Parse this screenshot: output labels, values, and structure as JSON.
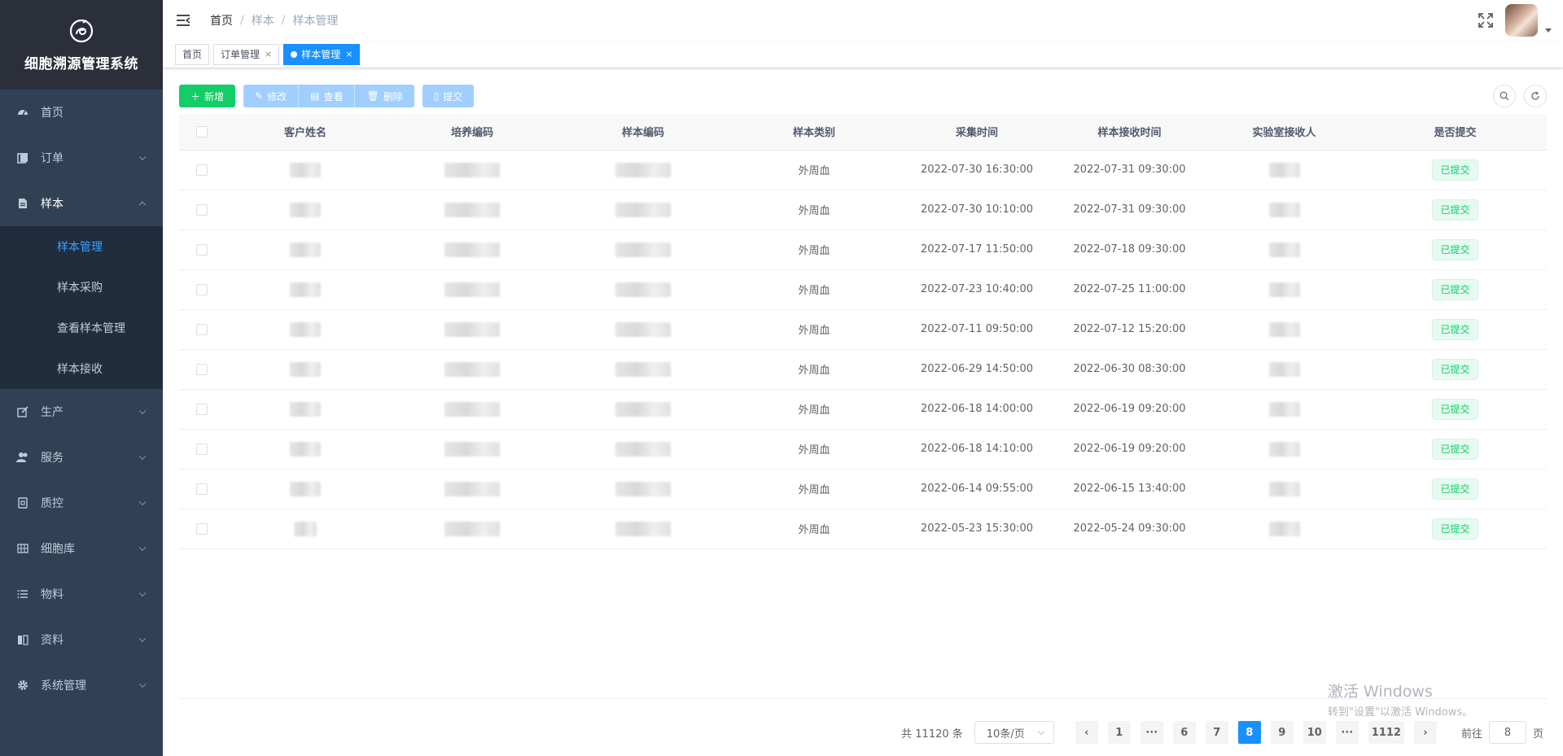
{
  "app": {
    "title": "细胞溯源管理系统"
  },
  "sidebar": {
    "items": [
      {
        "label": "首页",
        "icon": "dashboard-icon"
      },
      {
        "label": "订单",
        "icon": "order-icon",
        "expandable": true
      },
      {
        "label": "样本",
        "icon": "document-icon",
        "expandable": true,
        "expanded": true,
        "children": [
          {
            "label": "样本管理",
            "active": true
          },
          {
            "label": "样本采购"
          },
          {
            "label": "查看样本管理"
          },
          {
            "label": "样本接收"
          }
        ]
      },
      {
        "label": "生产",
        "icon": "edit-icon",
        "expandable": true
      },
      {
        "label": "服务",
        "icon": "peoples-icon",
        "expandable": true
      },
      {
        "label": "质控",
        "icon": "log-icon",
        "expandable": true
      },
      {
        "label": "细胞库",
        "icon": "grid-icon",
        "expandable": true
      },
      {
        "label": "物料",
        "icon": "list-icon",
        "expandable": true
      },
      {
        "label": "资料",
        "icon": "book-icon",
        "expandable": true
      },
      {
        "label": "系统管理",
        "icon": "gear-icon",
        "expandable": true
      }
    ]
  },
  "breadcrumb": [
    "首页",
    "样本",
    "样本管理"
  ],
  "tags": [
    {
      "label": "首页",
      "active": false,
      "closable": false
    },
    {
      "label": "订单管理",
      "active": false,
      "closable": true
    },
    {
      "label": "样本管理",
      "active": true,
      "closable": true
    }
  ],
  "toolbar": {
    "add": "新增",
    "edit": "修改",
    "view": "查看",
    "delete": "删除",
    "submit": "提交"
  },
  "table": {
    "columns": [
      "客户姓名",
      "培养编码",
      "样本编码",
      "样本类别",
      "采集时间",
      "样本接收时间",
      "实验室接收人",
      "是否提交"
    ],
    "rows": [
      {
        "category": "外周血",
        "collect_time": "2022-07-30 16:30:00",
        "receive_time": "2022-07-31 09:30:00",
        "status": "已提交"
      },
      {
        "category": "外周血",
        "collect_time": "2022-07-30 10:10:00",
        "receive_time": "2022-07-31 09:30:00",
        "status": "已提交"
      },
      {
        "category": "外周血",
        "collect_time": "2022-07-17 11:50:00",
        "receive_time": "2022-07-18 09:30:00",
        "status": "已提交"
      },
      {
        "category": "外周血",
        "collect_time": "2022-07-23 10:40:00",
        "receive_time": "2022-07-25 11:00:00",
        "status": "已提交"
      },
      {
        "category": "外周血",
        "collect_time": "2022-07-11 09:50:00",
        "receive_time": "2022-07-12 15:20:00",
        "status": "已提交"
      },
      {
        "category": "外周血",
        "collect_time": "2022-06-29 14:50:00",
        "receive_time": "2022-06-30 08:30:00",
        "status": "已提交"
      },
      {
        "category": "外周血",
        "collect_time": "2022-06-18 14:00:00",
        "receive_time": "2022-06-19 09:20:00",
        "status": "已提交"
      },
      {
        "category": "外周血",
        "collect_time": "2022-06-18 14:10:00",
        "receive_time": "2022-06-19 09:20:00",
        "status": "已提交"
      },
      {
        "category": "外周血",
        "collect_time": "2022-06-14 09:55:00",
        "receive_time": "2022-06-15 13:40:00",
        "status": "已提交"
      },
      {
        "category": "外周血",
        "collect_time": "2022-05-23 15:30:00",
        "receive_time": "2022-05-24 09:30:00",
        "status": "已提交"
      }
    ]
  },
  "pagination": {
    "total_text": "共 11120 条",
    "page_size": "10条/页",
    "pages": [
      "1",
      "···",
      "6",
      "7",
      "8",
      "9",
      "10",
      "···",
      "1112"
    ],
    "current": "8",
    "jump_prefix": "前往",
    "jump_value": "8",
    "jump_suffix": "页"
  },
  "watermark": {
    "line1": "激活 Windows",
    "line2": "转到\"设置\"以激活 Windows。"
  },
  "colors": {
    "sidebar_bg": "#304156",
    "primary": "#1890ff",
    "success": "#13ce66"
  }
}
